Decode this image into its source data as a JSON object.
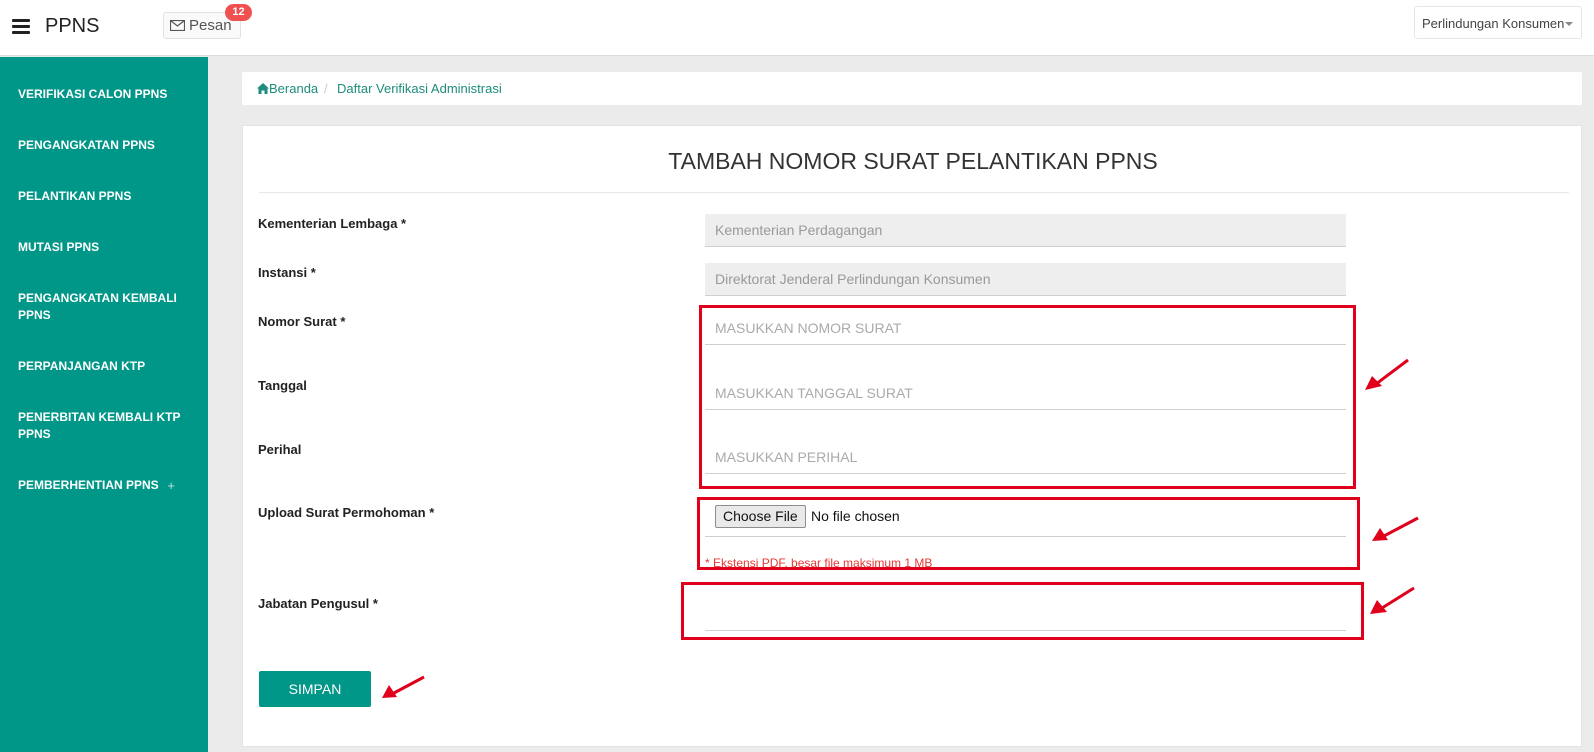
{
  "header": {
    "brand": "PPNS",
    "messages_label": "Pesan",
    "messages_count": "12",
    "user_menu": "Perlindungan Konsumen"
  },
  "sidebar": {
    "items": [
      {
        "label": "VERIFIKASI CALON PPNS"
      },
      {
        "label": "PENGANGKATAN PPNS"
      },
      {
        "label": "PELANTIKAN PPNS"
      },
      {
        "label": "MUTASI PPNS"
      },
      {
        "label": "PENGANGKATAN KEMBALI PPNS"
      },
      {
        "label": "PERPANJANGAN KTP"
      },
      {
        "label": "PENERBITAN KEMBALI KTP PPNS"
      },
      {
        "label": "PEMBERHENTIAN PPNS",
        "expand": "+"
      }
    ]
  },
  "breadcrumb": {
    "home": "Beranda",
    "separator": "/",
    "current": "Daftar Verifikasi Administrasi"
  },
  "form": {
    "title": "TAMBAH NOMOR SURAT PELANTIKAN PPNS",
    "fields": {
      "kementerian": {
        "label": "Kementerian Lembaga *",
        "value": "Kementerian Perdagangan"
      },
      "instansi": {
        "label": "Instansi *",
        "value": "Direktorat Jenderal Perlindungan Konsumen"
      },
      "nomor_surat": {
        "label": "Nomor Surat *",
        "placeholder": "MASUKKAN NOMOR SURAT"
      },
      "tanggal": {
        "label": "Tanggal",
        "placeholder": "MASUKKAN TANGGAL SURAT"
      },
      "perihal": {
        "label": "Perihal",
        "placeholder": "MASUKKAN PERIHAL"
      },
      "upload": {
        "label": "Upload Surat Permohoman *",
        "button": "Choose File",
        "status": "No file chosen",
        "hint": "* Ekstensi PDF, besar file maksimum 1 MB"
      },
      "jabatan": {
        "label": "Jabatan Pengusul *",
        "value": ""
      }
    },
    "submit_label": "SIMPAN"
  },
  "colors": {
    "primary": "#009688",
    "annotation": "#e0001b",
    "badge": "#f05050",
    "hint": "#e53935"
  }
}
